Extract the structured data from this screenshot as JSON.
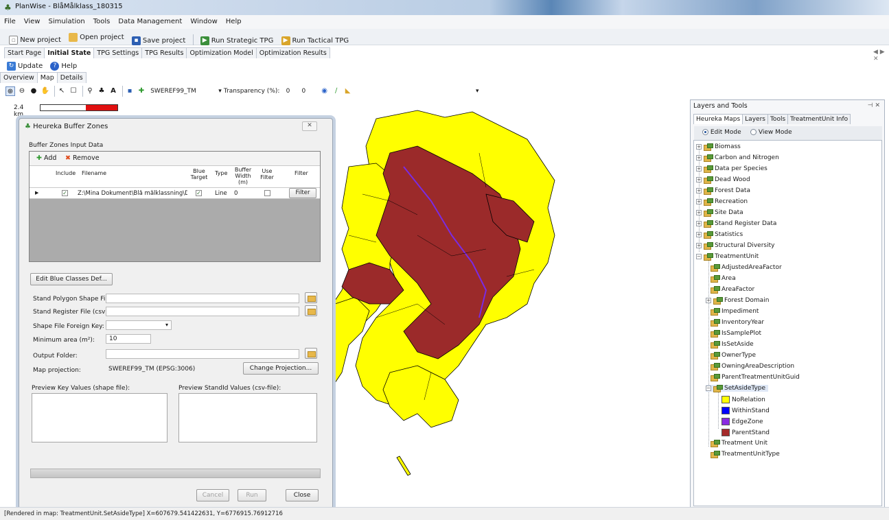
{
  "window": {
    "title": "PlanWise - BlåMålklass_180315"
  },
  "menu": [
    "File",
    "View",
    "Simulation",
    "Tools",
    "Data Management",
    "Window",
    "Help"
  ],
  "toolbar": {
    "new_project": "New project",
    "open_project": "Open project",
    "save_project": "Save project",
    "run_strategic": "Run Strategic TPG",
    "run_tactical": "Run Tactical TPG"
  },
  "main_tabs": [
    "Start Page",
    "Initial State",
    "TPG Settings",
    "TPG Results",
    "Optimization Model",
    "Optimization Results"
  ],
  "main_tabs_active": "Initial State",
  "tab_scroll": "◀ ▶ ✕",
  "secondary_toolbar": {
    "update": "Update",
    "help": "Help"
  },
  "sub_tabs": [
    "Overview",
    "Map",
    "Details"
  ],
  "map_toolbar": {
    "projection": "SWEREF99_TM",
    "transparency_label": "Transparency (%):",
    "transparency_value1": "0",
    "transparency_value2": "0"
  },
  "scalebar": {
    "label": "2.4 km"
  },
  "dialog": {
    "title": "Heureka Buffer Zones",
    "group_label": "Buffer Zones Input Data",
    "add_label": "Add",
    "remove_label": "Remove",
    "columns": [
      "Include",
      "Filename",
      "Blue Target",
      "Type",
      "Buffer Width (m)",
      "Use Filter",
      "Filter"
    ],
    "row": {
      "include": "✓",
      "filename": "Z:\\Mina Dokument\\Blå målklassning\\Dat...",
      "blue_target": "✓",
      "type": "Line",
      "buffer_width": "0",
      "use_filter": "",
      "filter_button": "Filter"
    },
    "edit_blue_classes": "Edit Blue Classes Def...",
    "stand_polygon_label": "Stand Polygon Shape File:",
    "stand_register_label": "Stand Register File (csv):",
    "foreign_key_label": "Shape File Foreign Key:",
    "min_area_label": "Minimum area (m²):",
    "min_area_value": "10",
    "output_folder_label": "Output Folder:",
    "map_projection_label": "Map projection:",
    "map_projection_value": "SWEREF99_TM (EPSG:3006)",
    "change_projection": "Change Projection...",
    "preview_key_label": "Preview Key Values (shape file):",
    "preview_stand_label": "Preview StandId Values (csv-file):",
    "cancel": "Cancel",
    "run": "Run",
    "close": "Close"
  },
  "layers_panel": {
    "title": "Layers and Tools",
    "tabs": [
      "Heureka Maps",
      "Layers",
      "Tools",
      "TreatmentUnit Info"
    ],
    "edit_mode": "Edit Mode",
    "view_mode": "View Mode",
    "tree_top": [
      "Biomass",
      "Carbon and Nitrogen",
      "Data per Species",
      "Dead Wood",
      "Forest Data",
      "Recreation",
      "Site Data",
      "Stand Register Data",
      "Statistics",
      "Structural Diversity",
      "TreatmentUnit"
    ],
    "treatment_children": [
      "AdjustedAreaFactor",
      "Area",
      "AreaFactor",
      "Forest Domain",
      "Impediment",
      "InventoryYear",
      "IsSamplePlot",
      "IsSetAside",
      "OwnerType",
      "OwningAreaDescription",
      "ParentTreatmentUnitGuid",
      "SetAsideType"
    ],
    "legend": [
      {
        "label": "NoRelation",
        "color": "#ffff00"
      },
      {
        "label": "WithinStand",
        "color": "#0000ff"
      },
      {
        "label": "EdgeZone",
        "color": "#8a2be2"
      },
      {
        "label": "ParentStand",
        "color": "#a52a2a"
      }
    ],
    "tree_bottom": [
      "Treatment Unit",
      "TreatmentUnitType"
    ]
  },
  "map_colors": {
    "land": "#ffff00",
    "parent_stand": "#9b2a2a",
    "edge_zone": "#7a2be2",
    "outline": "#000000"
  },
  "status": {
    "text": "[Rendered in map: TreatmentUnit.SetAsideType]  X=607679.541422631, Y=6776915.76912716"
  }
}
